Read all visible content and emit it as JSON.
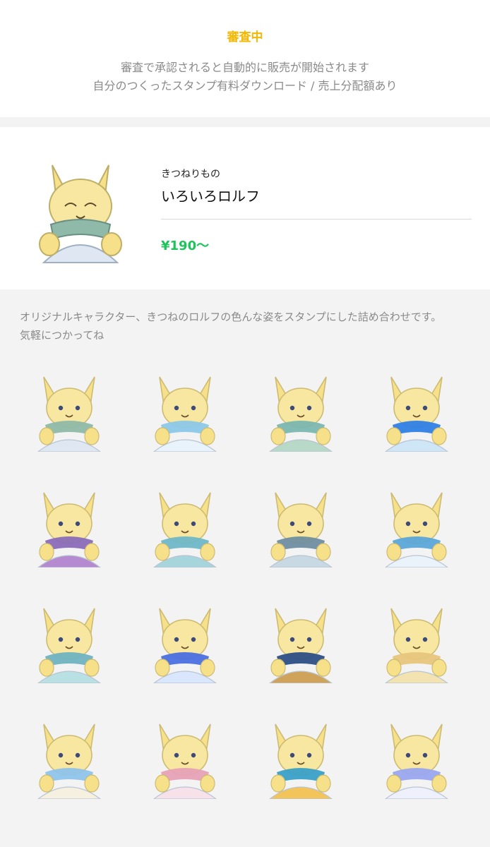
{
  "status": {
    "label": "審査中",
    "line1": "審査で承認されると自動的に販売が開始されます",
    "line2": "自分のつくったスタンプ有料ダウンロード / 売上分配額あり",
    "color": "#f5b700"
  },
  "product": {
    "author": "きつねりもの",
    "title": "いろいろロルフ",
    "price": "¥190〜",
    "price_color": "#1fc35b"
  },
  "description": {
    "line1": "オリジナルキャラクター、きつねのロルフの色んな姿をスタンプにした詰め合わせです。",
    "line2": "気軽につかってね"
  },
  "stickers": [
    {
      "icon": "fox-sticker-1-icon",
      "scarf": "#8fb9a8",
      "body": "#dfe8f2"
    },
    {
      "icon": "fox-sticker-2-icon",
      "scarf": "#8cc8e8",
      "body": "#e9f3fb"
    },
    {
      "icon": "fox-sticker-3-icon",
      "scarf": "#7bb6b0",
      "body": "#b9d9c8"
    },
    {
      "icon": "fox-sticker-4-icon",
      "scarf": "#2f7fe6",
      "body": "#cfe6f7"
    },
    {
      "icon": "fox-sticker-5-icon",
      "scarf": "#8a6bb8",
      "body": "#b58ad0"
    },
    {
      "icon": "fox-sticker-6-icon",
      "scarf": "#6fb7c8",
      "body": "#a6d6dc"
    },
    {
      "icon": "fox-sticker-7-icon",
      "scarf": "#6f8ea0",
      "body": "#c9d9e4"
    },
    {
      "icon": "fox-sticker-8-icon",
      "scarf": "#5aa6d8",
      "body": "#eaf2fa"
    },
    {
      "icon": "fox-sticker-9-icon",
      "scarf": "#6fb3c0",
      "body": "#b9e0e3"
    },
    {
      "icon": "fox-sticker-10-icon",
      "scarf": "#4a6fe0",
      "body": "#d9e6fb"
    },
    {
      "icon": "fox-sticker-11-icon",
      "scarf": "#2d4f86",
      "body": "#cfa45a"
    },
    {
      "icon": "fox-sticker-12-icon",
      "scarf": "#e7c57c",
      "body": "#f3e3b0"
    },
    {
      "icon": "fox-sticker-13-icon",
      "scarf": "#8fc3ea",
      "body": "#f6f0e0"
    },
    {
      "icon": "fox-sticker-14-icon",
      "scarf": "#e7a1b6",
      "body": "#f7e2ea"
    },
    {
      "icon": "fox-sticker-15-icon",
      "scarf": "#3aa0c8",
      "body": "#f2c45a"
    },
    {
      "icon": "fox-sticker-16-icon",
      "scarf": "#9aa6f0",
      "body": "#eef0fb"
    }
  ]
}
